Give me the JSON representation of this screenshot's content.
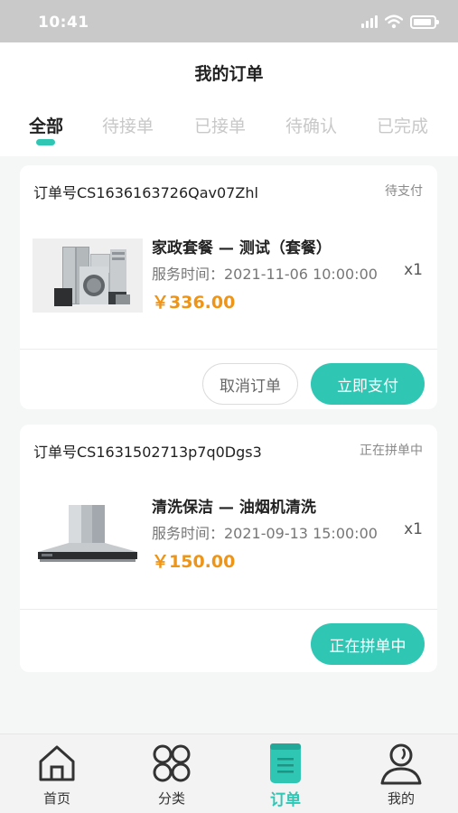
{
  "status_bar": {
    "time": "10:41"
  },
  "header": {
    "title": "我的订单"
  },
  "tabs": [
    {
      "label": "全部",
      "active": true
    },
    {
      "label": "待接单",
      "active": false
    },
    {
      "label": "已接单",
      "active": false
    },
    {
      "label": "待确认",
      "active": false
    },
    {
      "label": "已完成",
      "active": false
    }
  ],
  "orders": [
    {
      "order_no": "订单号CS1636163726Qav07Zhl",
      "status": "待支付",
      "product_name": "家政套餐 — 测试（套餐）",
      "service_time": "服务时间：2021-11-06 10:00:00",
      "quantity": "x1",
      "price": "￥336.00",
      "thumbnail_icon": "appliances-image",
      "actions": [
        {
          "label": "取消订单",
          "style": "outline"
        },
        {
          "label": "立即支付",
          "style": "primary"
        }
      ]
    },
    {
      "order_no": "订单号CS1631502713p7q0Dgs3",
      "status": "正在拼单中",
      "product_name": "清洗保洁 — 油烟机清洗",
      "service_time": "服务时间：2021-09-13 15:00:00",
      "quantity": "x1",
      "price": "￥150.00",
      "thumbnail_icon": "range-hood-image",
      "actions": [
        {
          "label": "正在拼单中",
          "style": "primary"
        }
      ]
    }
  ],
  "tabbar": [
    {
      "label": "首页",
      "icon": "home-icon",
      "active": false
    },
    {
      "label": "分类",
      "icon": "category-icon",
      "active": false
    },
    {
      "label": "订单",
      "icon": "order-icon",
      "active": true
    },
    {
      "label": "我的",
      "icon": "profile-icon",
      "active": false
    }
  ],
  "colors": {
    "accent": "#2fc6b4",
    "price": "#ee9417"
  }
}
